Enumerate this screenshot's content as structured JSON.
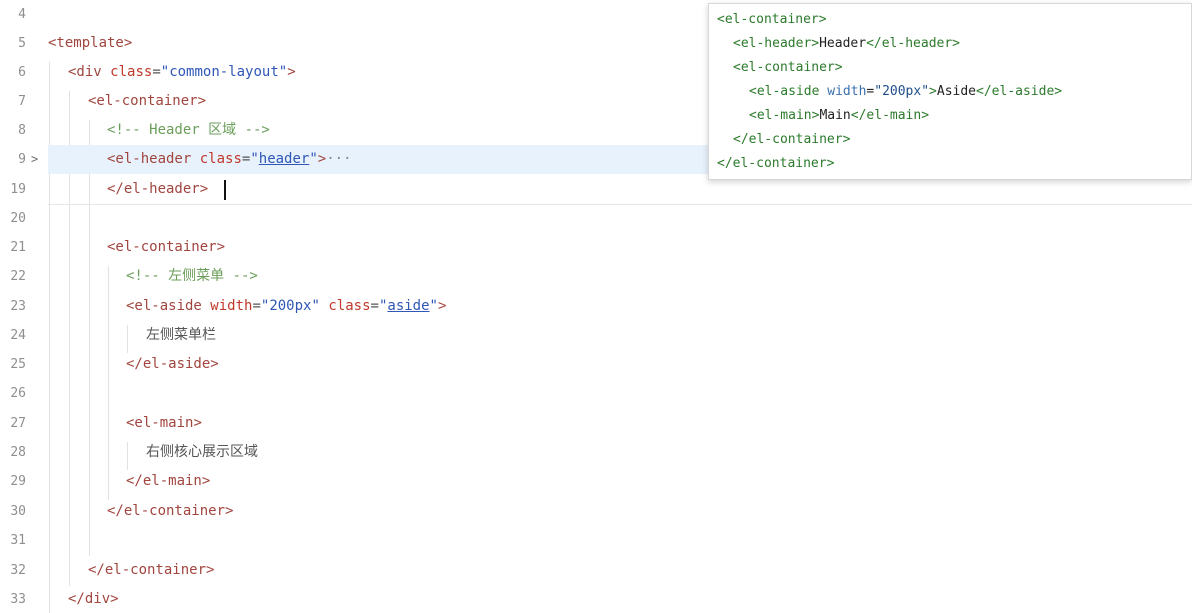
{
  "editor": {
    "lines": {
      "l4": {
        "num": "4"
      },
      "l5": {
        "num": "5",
        "open": "<template",
        "close": ">"
      },
      "l6": {
        "num": "6",
        "open": "<div",
        "attr": "class",
        "eq": "=",
        "q1": "\"",
        "value": "common-layout",
        "q2": "\"",
        "close": ">"
      },
      "l7": {
        "num": "7",
        "open": "<el-container",
        "close": ">"
      },
      "l8": {
        "num": "8",
        "comment": "<!-- Header 区域 -->"
      },
      "l9": {
        "num": "9",
        "fold": ">",
        "open": "<el-header",
        "attr": "class",
        "eq": "=",
        "q1": "\"",
        "value": "header",
        "q2": "\"",
        "close": ">",
        "ellipsis": "···"
      },
      "l19": {
        "num": "19",
        "tag": "</el-header>"
      },
      "l20": {
        "num": "20"
      },
      "l21": {
        "num": "21",
        "open": "<el-container",
        "close": ">"
      },
      "l22": {
        "num": "22",
        "comment": "<!-- 左侧菜单 -->"
      },
      "l23": {
        "num": "23",
        "open": "<el-aside",
        "attr": "width",
        "eq": "=",
        "q1": "\"",
        "value": "200px",
        "q2": "\"",
        "attr2": "class",
        "eq2": "=",
        "q3": "\"",
        "value2": "aside",
        "q4": "\"",
        "close": ">"
      },
      "l24": {
        "num": "24",
        "text": "左侧菜单栏"
      },
      "l25": {
        "num": "25",
        "tag": "</el-aside>"
      },
      "l26": {
        "num": "26"
      },
      "l27": {
        "num": "27",
        "open": "<el-main",
        "close": ">"
      },
      "l28": {
        "num": "28",
        "text": "右侧核心展示区域"
      },
      "l29": {
        "num": "29",
        "tag": "</el-main>"
      },
      "l30": {
        "num": "30",
        "tag": "</el-container>"
      },
      "l31": {
        "num": "31"
      },
      "l32": {
        "num": "32",
        "tag": "</el-container>"
      },
      "l33": {
        "num": "33",
        "tag": "</div>"
      }
    }
  },
  "tooltip": {
    "t1": {
      "open": "<el-container",
      "close": ">"
    },
    "t2": {
      "open": "<el-header",
      "gt": ">",
      "text": "Header",
      "end": "</el-header",
      "close": ">"
    },
    "t3": {
      "open": "<el-container",
      "close": ">"
    },
    "t4": {
      "open": "<el-aside",
      "attr": "width",
      "eq": "=",
      "value": "\"200px\"",
      "gt": ">",
      "text": "Aside",
      "end": "</el-aside",
      "close": ">"
    },
    "t5": {
      "open": "<el-main",
      "gt": ">",
      "text": "Main",
      "end": "</el-main",
      "close": ">"
    },
    "t6": {
      "open": "</el-container",
      "close": ">"
    },
    "t7": {
      "open": "</el-container",
      "close": ">"
    }
  }
}
